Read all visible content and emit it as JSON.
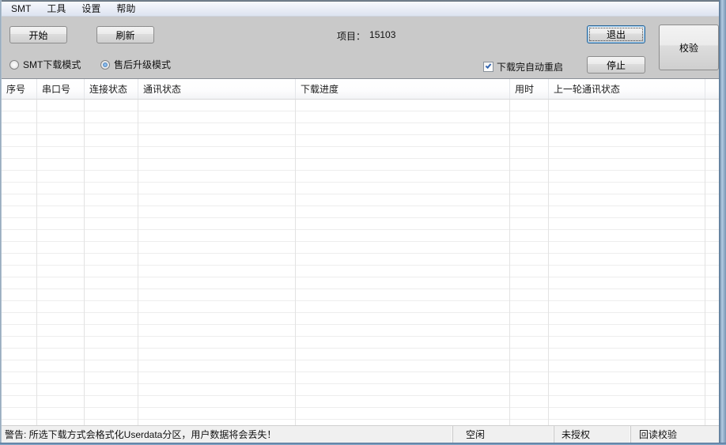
{
  "menu": {
    "items": [
      "SMT",
      "工具",
      "设置",
      "帮助"
    ]
  },
  "toolbar": {
    "start_label": "开始",
    "refresh_label": "刷新",
    "project_label": "项目：",
    "project_value": "15103",
    "exit_label": "退出",
    "stop_label": "停止",
    "verify_label": "校验",
    "radio_smt": {
      "label": "SMT下载模式",
      "selected": false
    },
    "radio_aftersales": {
      "label": "售后升级模式",
      "selected": true
    },
    "checkbox_auto_reboot": {
      "label": "下载完自动重启",
      "checked": true
    }
  },
  "table": {
    "columns": [
      "序号",
      "串口号",
      "连接状态",
      "通讯状态",
      "下载进度",
      "用时",
      "上一轮通讯状态"
    ],
    "rows": []
  },
  "statusbar": {
    "warning": "警告: 所选下载方式会格式化Userdata分区，用户数据将会丢失！",
    "state": "空闲",
    "auth": "未授权",
    "verify_mode": "回读校验"
  },
  "colors": {
    "accent_focus": "#2a6496",
    "toolbar_bg": "#c9c9c9",
    "border_blue": "#7795b3"
  }
}
